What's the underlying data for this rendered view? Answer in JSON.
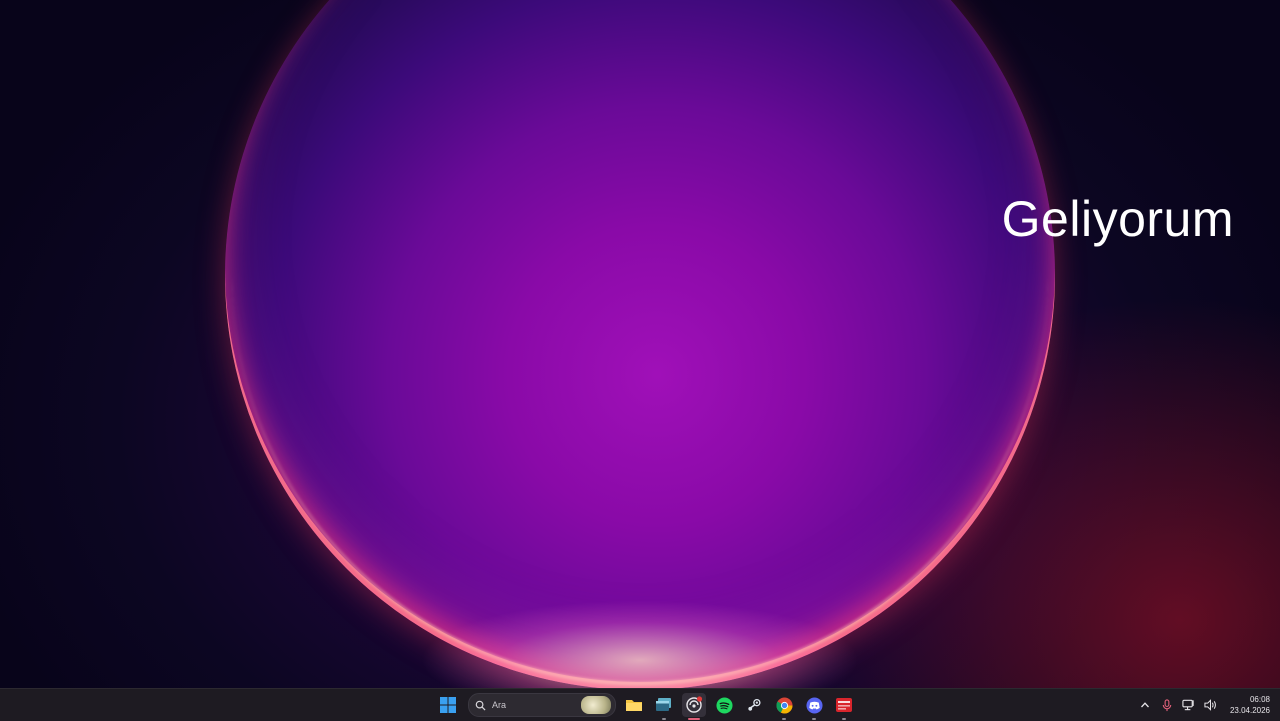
{
  "desktop": {
    "overlay_text": "Geliyorum",
    "wallpaper": "windows-11-bloom-purple"
  },
  "taskbar": {
    "search_placeholder": "Ara",
    "pinned": [
      {
        "name": "start",
        "icon": "windows-logo-icon"
      },
      {
        "name": "file-explorer",
        "icon": "folder-icon"
      },
      {
        "name": "task-view",
        "icon": "window-stack-icon"
      },
      {
        "name": "recording-app",
        "icon": "record-icon",
        "badge": true
      },
      {
        "name": "spotify",
        "icon": "spotify-icon"
      },
      {
        "name": "steam",
        "icon": "steam-icon"
      },
      {
        "name": "chrome",
        "icon": "chrome-icon"
      },
      {
        "name": "discord",
        "icon": "discord-icon"
      },
      {
        "name": "video-editor",
        "icon": "video-editor-icon"
      }
    ],
    "tray": {
      "time": "06:08",
      "date": "23.04.2026"
    }
  },
  "colors": {
    "taskbar_bg": "#1e1b22",
    "accent": "#e0607a",
    "windows_blue": "#3aa0f0",
    "spotify_green": "#1ed760",
    "discord_blurple": "#5865f2"
  }
}
